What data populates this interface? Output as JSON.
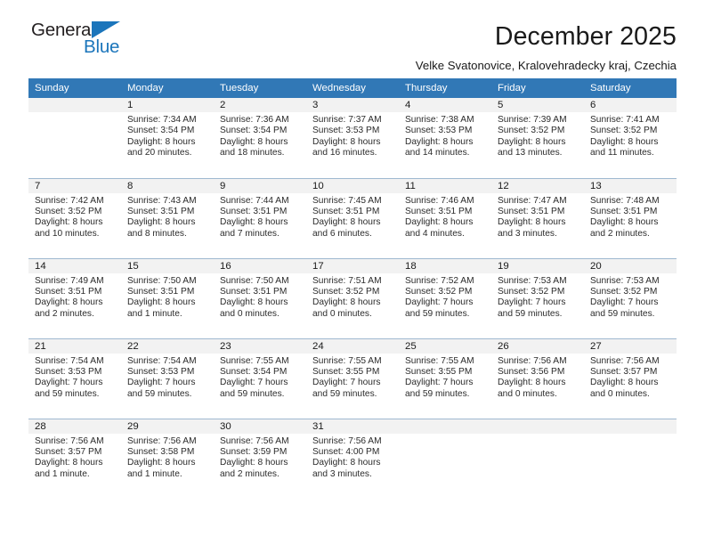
{
  "brand": {
    "name_top": "General",
    "name_bottom": "Blue",
    "triangle_color": "#1b75bb",
    "text_color": "#231f20"
  },
  "header": {
    "title": "December 2025",
    "subtitle": "Velke Svatonovice, Kralovehradecky kraj, Czechia"
  },
  "colors": {
    "header_row_bg": "#3178b6",
    "header_row_text": "#ffffff",
    "daynumber_band_bg": "#f2f2f2",
    "grid_line": "#9fb8d0",
    "body_text": "#2b2b2b"
  },
  "weekdays": [
    "Sunday",
    "Monday",
    "Tuesday",
    "Wednesday",
    "Thursday",
    "Friday",
    "Saturday"
  ],
  "weeks": [
    [
      {
        "day": "",
        "empty": true
      },
      {
        "day": "1",
        "sunrise": "Sunrise: 7:34 AM",
        "sunset": "Sunset: 3:54 PM",
        "daylight": "Daylight: 8 hours and 20 minutes."
      },
      {
        "day": "2",
        "sunrise": "Sunrise: 7:36 AM",
        "sunset": "Sunset: 3:54 PM",
        "daylight": "Daylight: 8 hours and 18 minutes."
      },
      {
        "day": "3",
        "sunrise": "Sunrise: 7:37 AM",
        "sunset": "Sunset: 3:53 PM",
        "daylight": "Daylight: 8 hours and 16 minutes."
      },
      {
        "day": "4",
        "sunrise": "Sunrise: 7:38 AM",
        "sunset": "Sunset: 3:53 PM",
        "daylight": "Daylight: 8 hours and 14 minutes."
      },
      {
        "day": "5",
        "sunrise": "Sunrise: 7:39 AM",
        "sunset": "Sunset: 3:52 PM",
        "daylight": "Daylight: 8 hours and 13 minutes."
      },
      {
        "day": "6",
        "sunrise": "Sunrise: 7:41 AM",
        "sunset": "Sunset: 3:52 PM",
        "daylight": "Daylight: 8 hours and 11 minutes."
      }
    ],
    [
      {
        "day": "7",
        "sunrise": "Sunrise: 7:42 AM",
        "sunset": "Sunset: 3:52 PM",
        "daylight": "Daylight: 8 hours and 10 minutes."
      },
      {
        "day": "8",
        "sunrise": "Sunrise: 7:43 AM",
        "sunset": "Sunset: 3:51 PM",
        "daylight": "Daylight: 8 hours and 8 minutes."
      },
      {
        "day": "9",
        "sunrise": "Sunrise: 7:44 AM",
        "sunset": "Sunset: 3:51 PM",
        "daylight": "Daylight: 8 hours and 7 minutes."
      },
      {
        "day": "10",
        "sunrise": "Sunrise: 7:45 AM",
        "sunset": "Sunset: 3:51 PM",
        "daylight": "Daylight: 8 hours and 6 minutes."
      },
      {
        "day": "11",
        "sunrise": "Sunrise: 7:46 AM",
        "sunset": "Sunset: 3:51 PM",
        "daylight": "Daylight: 8 hours and 4 minutes."
      },
      {
        "day": "12",
        "sunrise": "Sunrise: 7:47 AM",
        "sunset": "Sunset: 3:51 PM",
        "daylight": "Daylight: 8 hours and 3 minutes."
      },
      {
        "day": "13",
        "sunrise": "Sunrise: 7:48 AM",
        "sunset": "Sunset: 3:51 PM",
        "daylight": "Daylight: 8 hours and 2 minutes."
      }
    ],
    [
      {
        "day": "14",
        "sunrise": "Sunrise: 7:49 AM",
        "sunset": "Sunset: 3:51 PM",
        "daylight": "Daylight: 8 hours and 2 minutes."
      },
      {
        "day": "15",
        "sunrise": "Sunrise: 7:50 AM",
        "sunset": "Sunset: 3:51 PM",
        "daylight": "Daylight: 8 hours and 1 minute."
      },
      {
        "day": "16",
        "sunrise": "Sunrise: 7:50 AM",
        "sunset": "Sunset: 3:51 PM",
        "daylight": "Daylight: 8 hours and 0 minutes."
      },
      {
        "day": "17",
        "sunrise": "Sunrise: 7:51 AM",
        "sunset": "Sunset: 3:52 PM",
        "daylight": "Daylight: 8 hours and 0 minutes."
      },
      {
        "day": "18",
        "sunrise": "Sunrise: 7:52 AM",
        "sunset": "Sunset: 3:52 PM",
        "daylight": "Daylight: 7 hours and 59 minutes."
      },
      {
        "day": "19",
        "sunrise": "Sunrise: 7:53 AM",
        "sunset": "Sunset: 3:52 PM",
        "daylight": "Daylight: 7 hours and 59 minutes."
      },
      {
        "day": "20",
        "sunrise": "Sunrise: 7:53 AM",
        "sunset": "Sunset: 3:52 PM",
        "daylight": "Daylight: 7 hours and 59 minutes."
      }
    ],
    [
      {
        "day": "21",
        "sunrise": "Sunrise: 7:54 AM",
        "sunset": "Sunset: 3:53 PM",
        "daylight": "Daylight: 7 hours and 59 minutes."
      },
      {
        "day": "22",
        "sunrise": "Sunrise: 7:54 AM",
        "sunset": "Sunset: 3:53 PM",
        "daylight": "Daylight: 7 hours and 59 minutes."
      },
      {
        "day": "23",
        "sunrise": "Sunrise: 7:55 AM",
        "sunset": "Sunset: 3:54 PM",
        "daylight": "Daylight: 7 hours and 59 minutes."
      },
      {
        "day": "24",
        "sunrise": "Sunrise: 7:55 AM",
        "sunset": "Sunset: 3:55 PM",
        "daylight": "Daylight: 7 hours and 59 minutes."
      },
      {
        "day": "25",
        "sunrise": "Sunrise: 7:55 AM",
        "sunset": "Sunset: 3:55 PM",
        "daylight": "Daylight: 7 hours and 59 minutes."
      },
      {
        "day": "26",
        "sunrise": "Sunrise: 7:56 AM",
        "sunset": "Sunset: 3:56 PM",
        "daylight": "Daylight: 8 hours and 0 minutes."
      },
      {
        "day": "27",
        "sunrise": "Sunrise: 7:56 AM",
        "sunset": "Sunset: 3:57 PM",
        "daylight": "Daylight: 8 hours and 0 minutes."
      }
    ],
    [
      {
        "day": "28",
        "sunrise": "Sunrise: 7:56 AM",
        "sunset": "Sunset: 3:57 PM",
        "daylight": "Daylight: 8 hours and 1 minute."
      },
      {
        "day": "29",
        "sunrise": "Sunrise: 7:56 AM",
        "sunset": "Sunset: 3:58 PM",
        "daylight": "Daylight: 8 hours and 1 minute."
      },
      {
        "day": "30",
        "sunrise": "Sunrise: 7:56 AM",
        "sunset": "Sunset: 3:59 PM",
        "daylight": "Daylight: 8 hours and 2 minutes."
      },
      {
        "day": "31",
        "sunrise": "Sunrise: 7:56 AM",
        "sunset": "Sunset: 4:00 PM",
        "daylight": "Daylight: 8 hours and 3 minutes."
      },
      {
        "day": "",
        "empty": true
      },
      {
        "day": "",
        "empty": true
      },
      {
        "day": "",
        "empty": true
      }
    ]
  ]
}
